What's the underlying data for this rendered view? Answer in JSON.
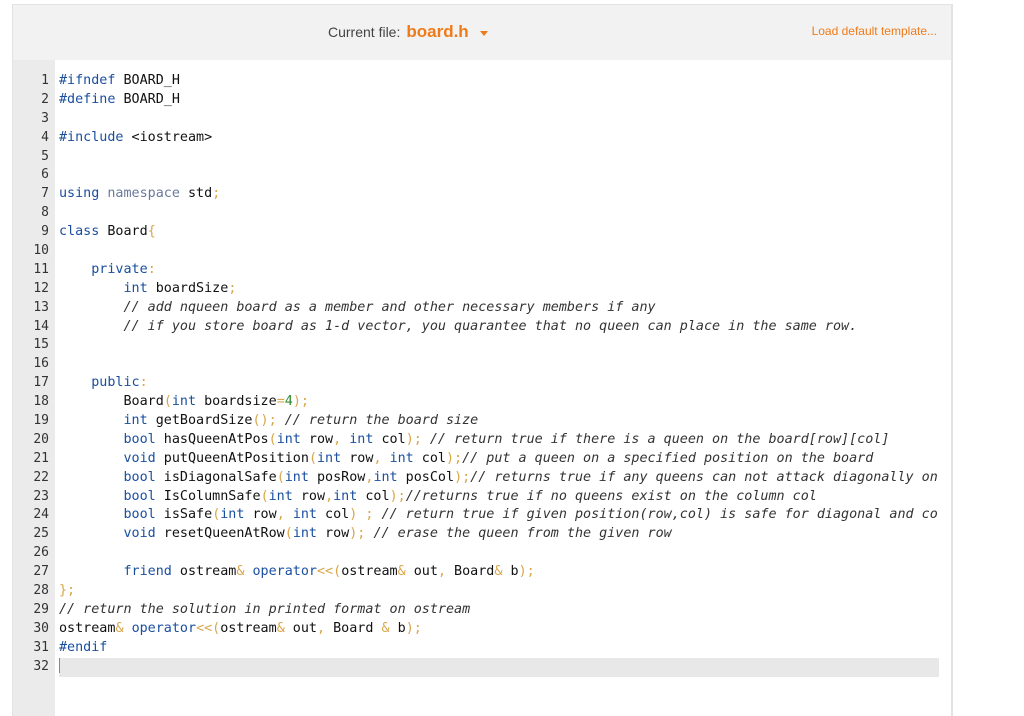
{
  "header": {
    "file_label": "Current file:",
    "file_name": "board.h",
    "load_template_label": "Load default template..."
  },
  "colors": {
    "accent": "#ee7b1a",
    "keyword": "#1a4fa0",
    "header_bg": "#f2f2f2",
    "gutter_bg": "#ebebeb"
  },
  "editor": {
    "lines": [
      {
        "n": "1",
        "tokens": [
          {
            "t": "#ifndef",
            "c": "pp"
          },
          {
            "t": " BOARD_H",
            "c": "plain"
          }
        ]
      },
      {
        "n": "2",
        "tokens": [
          {
            "t": "#define",
            "c": "pp"
          },
          {
            "t": " BOARD_H",
            "c": "plain"
          }
        ]
      },
      {
        "n": "3",
        "tokens": []
      },
      {
        "n": "4",
        "tokens": [
          {
            "t": "#include",
            "c": "pp"
          },
          {
            "t": " <iostream>",
            "c": "plain"
          }
        ]
      },
      {
        "n": "5",
        "tokens": []
      },
      {
        "n": "6",
        "tokens": []
      },
      {
        "n": "7",
        "tokens": [
          {
            "t": "using",
            "c": "kw"
          },
          {
            "t": " ",
            "c": "plain"
          },
          {
            "t": "namespace",
            "c": "ns"
          },
          {
            "t": " std",
            "c": "plain"
          },
          {
            "t": ";",
            "c": "op"
          }
        ]
      },
      {
        "n": "8",
        "tokens": []
      },
      {
        "n": "9",
        "tokens": [
          {
            "t": "class",
            "c": "kw"
          },
          {
            "t": " Board",
            "c": "plain"
          },
          {
            "t": "{",
            "c": "op"
          }
        ]
      },
      {
        "n": "10",
        "tokens": []
      },
      {
        "n": "11",
        "tokens": [
          {
            "t": "    ",
            "c": "plain"
          },
          {
            "t": "private",
            "c": "kw"
          },
          {
            "t": ":",
            "c": "op"
          }
        ]
      },
      {
        "n": "12",
        "tokens": [
          {
            "t": "        ",
            "c": "plain"
          },
          {
            "t": "int",
            "c": "type"
          },
          {
            "t": " boardSize",
            "c": "plain"
          },
          {
            "t": ";",
            "c": "op"
          }
        ]
      },
      {
        "n": "13",
        "tokens": [
          {
            "t": "        ",
            "c": "plain"
          },
          {
            "t": "// add nqueen board as a member and other necessary members if any",
            "c": "comment"
          }
        ]
      },
      {
        "n": "14",
        "tokens": [
          {
            "t": "        ",
            "c": "plain"
          },
          {
            "t": "// if you store board as 1-d vector, you quarantee that no queen can place in the same row.",
            "c": "comment"
          }
        ]
      },
      {
        "n": "15",
        "tokens": []
      },
      {
        "n": "16",
        "tokens": []
      },
      {
        "n": "17",
        "tokens": [
          {
            "t": "    ",
            "c": "plain"
          },
          {
            "t": "public",
            "c": "kw"
          },
          {
            "t": ":",
            "c": "op"
          }
        ]
      },
      {
        "n": "18",
        "tokens": [
          {
            "t": "        Board",
            "c": "plain"
          },
          {
            "t": "(",
            "c": "op"
          },
          {
            "t": "int",
            "c": "type"
          },
          {
            "t": " boardsize",
            "c": "plain"
          },
          {
            "t": "=",
            "c": "op"
          },
          {
            "t": "4",
            "c": "num"
          },
          {
            "t": ");",
            "c": "op"
          }
        ]
      },
      {
        "n": "19",
        "tokens": [
          {
            "t": "        ",
            "c": "plain"
          },
          {
            "t": "int",
            "c": "type"
          },
          {
            "t": " getBoardSize",
            "c": "plain"
          },
          {
            "t": "();",
            "c": "op"
          },
          {
            "t": " ",
            "c": "plain"
          },
          {
            "t": "// return the board size",
            "c": "comment"
          }
        ]
      },
      {
        "n": "20",
        "tokens": [
          {
            "t": "        ",
            "c": "plain"
          },
          {
            "t": "bool",
            "c": "type"
          },
          {
            "t": " hasQueenAtPos",
            "c": "plain"
          },
          {
            "t": "(",
            "c": "op"
          },
          {
            "t": "int",
            "c": "type"
          },
          {
            "t": " row",
            "c": "plain"
          },
          {
            "t": ",",
            "c": "op"
          },
          {
            "t": " ",
            "c": "plain"
          },
          {
            "t": "int",
            "c": "type"
          },
          {
            "t": " col",
            "c": "plain"
          },
          {
            "t": ");",
            "c": "op"
          },
          {
            "t": " ",
            "c": "plain"
          },
          {
            "t": "// return true if there is a queen on the board[row][col]",
            "c": "comment"
          }
        ]
      },
      {
        "n": "21",
        "tokens": [
          {
            "t": "        ",
            "c": "plain"
          },
          {
            "t": "void",
            "c": "type"
          },
          {
            "t": " putQueenAtPosition",
            "c": "plain"
          },
          {
            "t": "(",
            "c": "op"
          },
          {
            "t": "int",
            "c": "type"
          },
          {
            "t": " row",
            "c": "plain"
          },
          {
            "t": ",",
            "c": "op"
          },
          {
            "t": " ",
            "c": "plain"
          },
          {
            "t": "int",
            "c": "type"
          },
          {
            "t": " col",
            "c": "plain"
          },
          {
            "t": ");",
            "c": "op"
          },
          {
            "t": "// put a queen on a specified position on the board",
            "c": "comment"
          }
        ]
      },
      {
        "n": "22",
        "tokens": [
          {
            "t": "        ",
            "c": "plain"
          },
          {
            "t": "bool",
            "c": "type"
          },
          {
            "t": " isDiagonalSafe",
            "c": "plain"
          },
          {
            "t": "(",
            "c": "op"
          },
          {
            "t": "int",
            "c": "type"
          },
          {
            "t": " posRow",
            "c": "plain"
          },
          {
            "t": ",",
            "c": "op"
          },
          {
            "t": "int",
            "c": "type"
          },
          {
            "t": " posCol",
            "c": "plain"
          },
          {
            "t": ");",
            "c": "op"
          },
          {
            "t": "// returns true if any queens can not attack diagonally on",
            "c": "comment"
          }
        ]
      },
      {
        "n": "23",
        "tokens": [
          {
            "t": "        ",
            "c": "plain"
          },
          {
            "t": "bool",
            "c": "type"
          },
          {
            "t": " IsColumnSafe",
            "c": "plain"
          },
          {
            "t": "(",
            "c": "op"
          },
          {
            "t": "int",
            "c": "type"
          },
          {
            "t": " row",
            "c": "plain"
          },
          {
            "t": ",",
            "c": "op"
          },
          {
            "t": "int",
            "c": "type"
          },
          {
            "t": " col",
            "c": "plain"
          },
          {
            "t": ");",
            "c": "op"
          },
          {
            "t": "//returns true if no queens exist on the column col",
            "c": "comment"
          }
        ]
      },
      {
        "n": "24",
        "tokens": [
          {
            "t": "        ",
            "c": "plain"
          },
          {
            "t": "bool",
            "c": "type"
          },
          {
            "t": " isSafe",
            "c": "plain"
          },
          {
            "t": "(",
            "c": "op"
          },
          {
            "t": "int",
            "c": "type"
          },
          {
            "t": " row",
            "c": "plain"
          },
          {
            "t": ",",
            "c": "op"
          },
          {
            "t": " ",
            "c": "plain"
          },
          {
            "t": "int",
            "c": "type"
          },
          {
            "t": " col",
            "c": "plain"
          },
          {
            "t": ")",
            "c": "op"
          },
          {
            "t": " ",
            "c": "plain"
          },
          {
            "t": ";",
            "c": "op"
          },
          {
            "t": " ",
            "c": "plain"
          },
          {
            "t": "// return true if given position(row,col) is safe for diagonal and co",
            "c": "comment"
          }
        ]
      },
      {
        "n": "25",
        "tokens": [
          {
            "t": "        ",
            "c": "plain"
          },
          {
            "t": "void",
            "c": "type"
          },
          {
            "t": " resetQueenAtRow",
            "c": "plain"
          },
          {
            "t": "(",
            "c": "op"
          },
          {
            "t": "int",
            "c": "type"
          },
          {
            "t": " row",
            "c": "plain"
          },
          {
            "t": ");",
            "c": "op"
          },
          {
            "t": " ",
            "c": "plain"
          },
          {
            "t": "// erase the queen from the given row",
            "c": "comment"
          }
        ]
      },
      {
        "n": "26",
        "tokens": []
      },
      {
        "n": "27",
        "tokens": [
          {
            "t": "        ",
            "c": "plain"
          },
          {
            "t": "friend",
            "c": "kw"
          },
          {
            "t": " ostream",
            "c": "plain"
          },
          {
            "t": "&",
            "c": "op"
          },
          {
            "t": " ",
            "c": "plain"
          },
          {
            "t": "operator",
            "c": "kw"
          },
          {
            "t": "<<(",
            "c": "op"
          },
          {
            "t": "ostream",
            "c": "plain"
          },
          {
            "t": "&",
            "c": "op"
          },
          {
            "t": " out",
            "c": "plain"
          },
          {
            "t": ",",
            "c": "op"
          },
          {
            "t": " Board",
            "c": "plain"
          },
          {
            "t": "&",
            "c": "op"
          },
          {
            "t": " b",
            "c": "plain"
          },
          {
            "t": ");",
            "c": "op"
          }
        ]
      },
      {
        "n": "28",
        "tokens": [
          {
            "t": "};",
            "c": "op"
          }
        ]
      },
      {
        "n": "29",
        "tokens": [
          {
            "t": "// return the solution in printed format on ostream",
            "c": "comment"
          }
        ]
      },
      {
        "n": "30",
        "tokens": [
          {
            "t": "ostream",
            "c": "plain"
          },
          {
            "t": "&",
            "c": "op"
          },
          {
            "t": " ",
            "c": "plain"
          },
          {
            "t": "operator",
            "c": "kw"
          },
          {
            "t": "<<(",
            "c": "op"
          },
          {
            "t": "ostream",
            "c": "plain"
          },
          {
            "t": "&",
            "c": "op"
          },
          {
            "t": " out",
            "c": "plain"
          },
          {
            "t": ",",
            "c": "op"
          },
          {
            "t": " Board ",
            "c": "plain"
          },
          {
            "t": "&",
            "c": "op"
          },
          {
            "t": " b",
            "c": "plain"
          },
          {
            "t": ");",
            "c": "op"
          }
        ]
      },
      {
        "n": "31",
        "tokens": [
          {
            "t": "#endif",
            "c": "pp"
          }
        ]
      },
      {
        "n": "32",
        "tokens": [],
        "active": true
      }
    ]
  }
}
